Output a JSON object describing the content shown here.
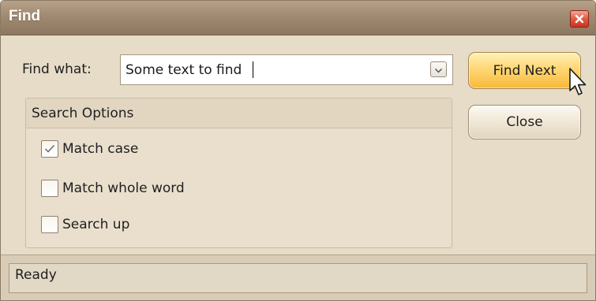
{
  "window": {
    "title": "Find"
  },
  "find": {
    "label": "Find what:",
    "value": "Some text to find"
  },
  "buttons": {
    "find_next": "Find Next",
    "close": "Close"
  },
  "options": {
    "title": "Search Options",
    "items": [
      {
        "label": "Match case",
        "checked": true
      },
      {
        "label": "Match whole word",
        "checked": false
      },
      {
        "label": "Search up",
        "checked": false
      }
    ]
  },
  "status": {
    "text": "Ready"
  },
  "colors": {
    "titlebar": "#a08a71",
    "window_bg": "#e7dcc8",
    "find_next_accent": "#ffd774",
    "close_button_red": "#e15a44"
  },
  "icons": {
    "window_close": "close-icon",
    "combo_dropdown": "chevron-down-icon",
    "checkmark": "check-icon",
    "pointer": "mouse-cursor-icon"
  }
}
